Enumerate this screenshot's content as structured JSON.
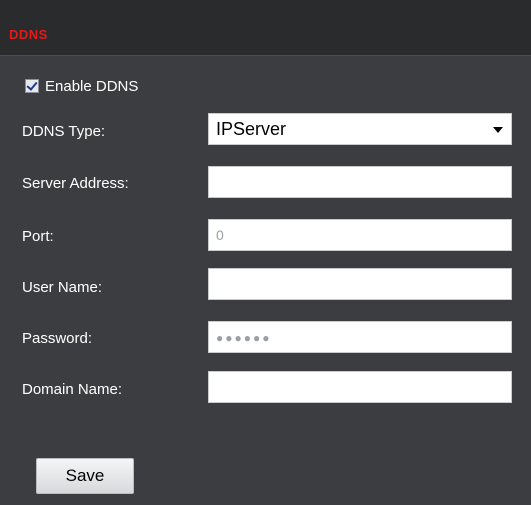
{
  "section": {
    "title": "DDNS",
    "title_color": "#e61a17"
  },
  "enable": {
    "label": "Enable DDNS",
    "checked": true
  },
  "fields": {
    "ddns_type": {
      "label": "DDNS Type:",
      "value": "IPServer"
    },
    "server_address": {
      "label": "Server Address:",
      "value": ""
    },
    "port": {
      "label": "Port:",
      "value": "0"
    },
    "user_name": {
      "label": "User Name:",
      "value": ""
    },
    "password": {
      "label": "Password:",
      "value": "●●●●●●"
    },
    "domain_name": {
      "label": "Domain Name:",
      "value": ""
    }
  },
  "actions": {
    "save_label": "Save"
  }
}
